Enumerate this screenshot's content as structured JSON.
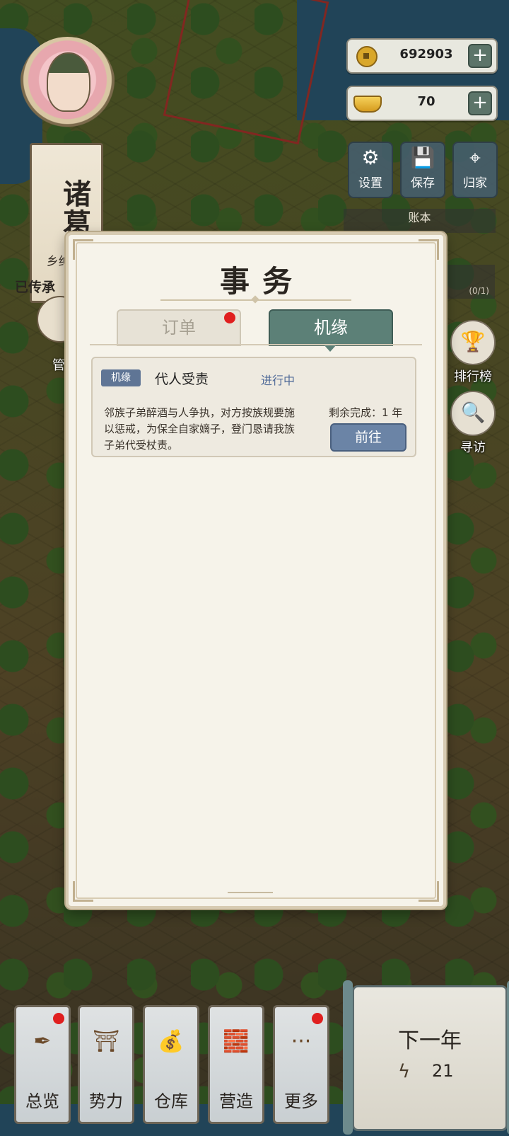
{
  "family": {
    "name": "诸葛氏",
    "rank": "乡绅·贰",
    "status": "已传承"
  },
  "currency": {
    "coins": {
      "value": "692903",
      "icon": "coin-icon"
    },
    "gold": {
      "value": "70",
      "icon": "gold-ingot-icon"
    },
    "plus_label": "+"
  },
  "top_buttons": [
    {
      "label": "设置",
      "icon": "gear-icon",
      "glyph": "⚙"
    },
    {
      "label": "保存",
      "icon": "save-icon",
      "glyph": "💾"
    },
    {
      "label": "归家",
      "icon": "location-pin-icon",
      "glyph": "⌖"
    }
  ],
  "ledger": {
    "title": "账本",
    "count": "(0/1)"
  },
  "side_buttons": [
    {
      "label": "排行榜",
      "icon": "trophy-icon",
      "glyph": "🏆"
    },
    {
      "label": "寻访",
      "icon": "magnifier-icon",
      "glyph": "🔍"
    }
  ],
  "steward_label": "管",
  "modal": {
    "title": "事务",
    "tabs": [
      {
        "label": "订单",
        "has_dot": true,
        "active": false
      },
      {
        "label": "机缘",
        "has_dot": false,
        "active": true
      }
    ],
    "tasks": [
      {
        "tag": "机缘",
        "name": "代人受责",
        "status": "进行中",
        "description": "邻族子弟醉酒与人争执，对方按族规要施以惩戒，为保全自家嫡子，登门恳请我族子弟代受杖责。",
        "remaining": "剩余完成：1 年",
        "action": "前往"
      }
    ]
  },
  "bottom_nav": [
    {
      "label": "总览",
      "icon": "scroll-brush-icon",
      "glyph": "✒",
      "has_dot": true
    },
    {
      "label": "势力",
      "icon": "palace-icon",
      "glyph": "⛩",
      "has_dot": false
    },
    {
      "label": "仓库",
      "icon": "money-bag-icon",
      "glyph": "💰",
      "has_dot": false
    },
    {
      "label": "营造",
      "icon": "bricks-trowel-icon",
      "glyph": "🧱",
      "has_dot": false
    },
    {
      "label": "更多",
      "icon": "more-dots-icon",
      "glyph": "···",
      "has_dot": true
    }
  ],
  "next_year": {
    "label": "下一年",
    "energy": "21",
    "icon": "lightning-icon"
  },
  "colors": {
    "accent_teal": "#5c8077",
    "accent_blue": "#6b84a6",
    "notify_red": "#e01f1f"
  }
}
